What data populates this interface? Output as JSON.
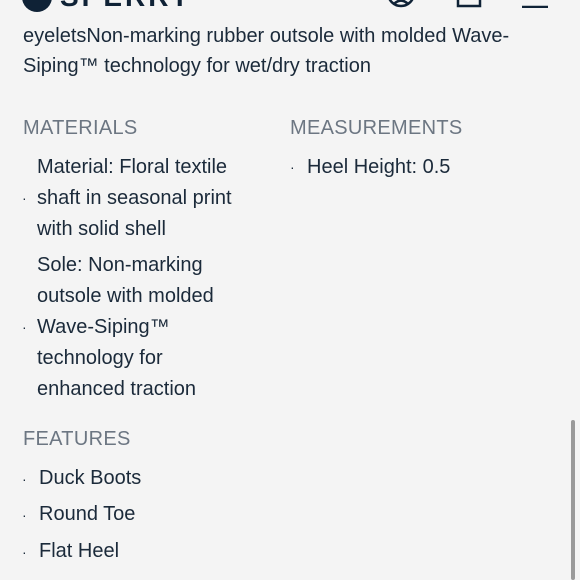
{
  "header": {
    "logo_text": "SPERRY"
  },
  "description": "eyeletsNon-marking rubber outsole with molded Wave-Siping™ technology for wet/dry traction",
  "materials": {
    "title": "MATERIALS",
    "items": [
      "Material: Floral textile shaft in seasonal print with solid shell",
      "Sole: Non-marking outsole with molded Wave-Siping™ technology for enhanced traction"
    ]
  },
  "measurements": {
    "title": "MEASUREMENTS",
    "items": [
      "Heel Height: 0.5"
    ]
  },
  "features": {
    "title": "FEATURES",
    "items": [
      "Duck Boots",
      "Round Toe",
      "Flat Heel"
    ]
  },
  "bullet_char": "·"
}
